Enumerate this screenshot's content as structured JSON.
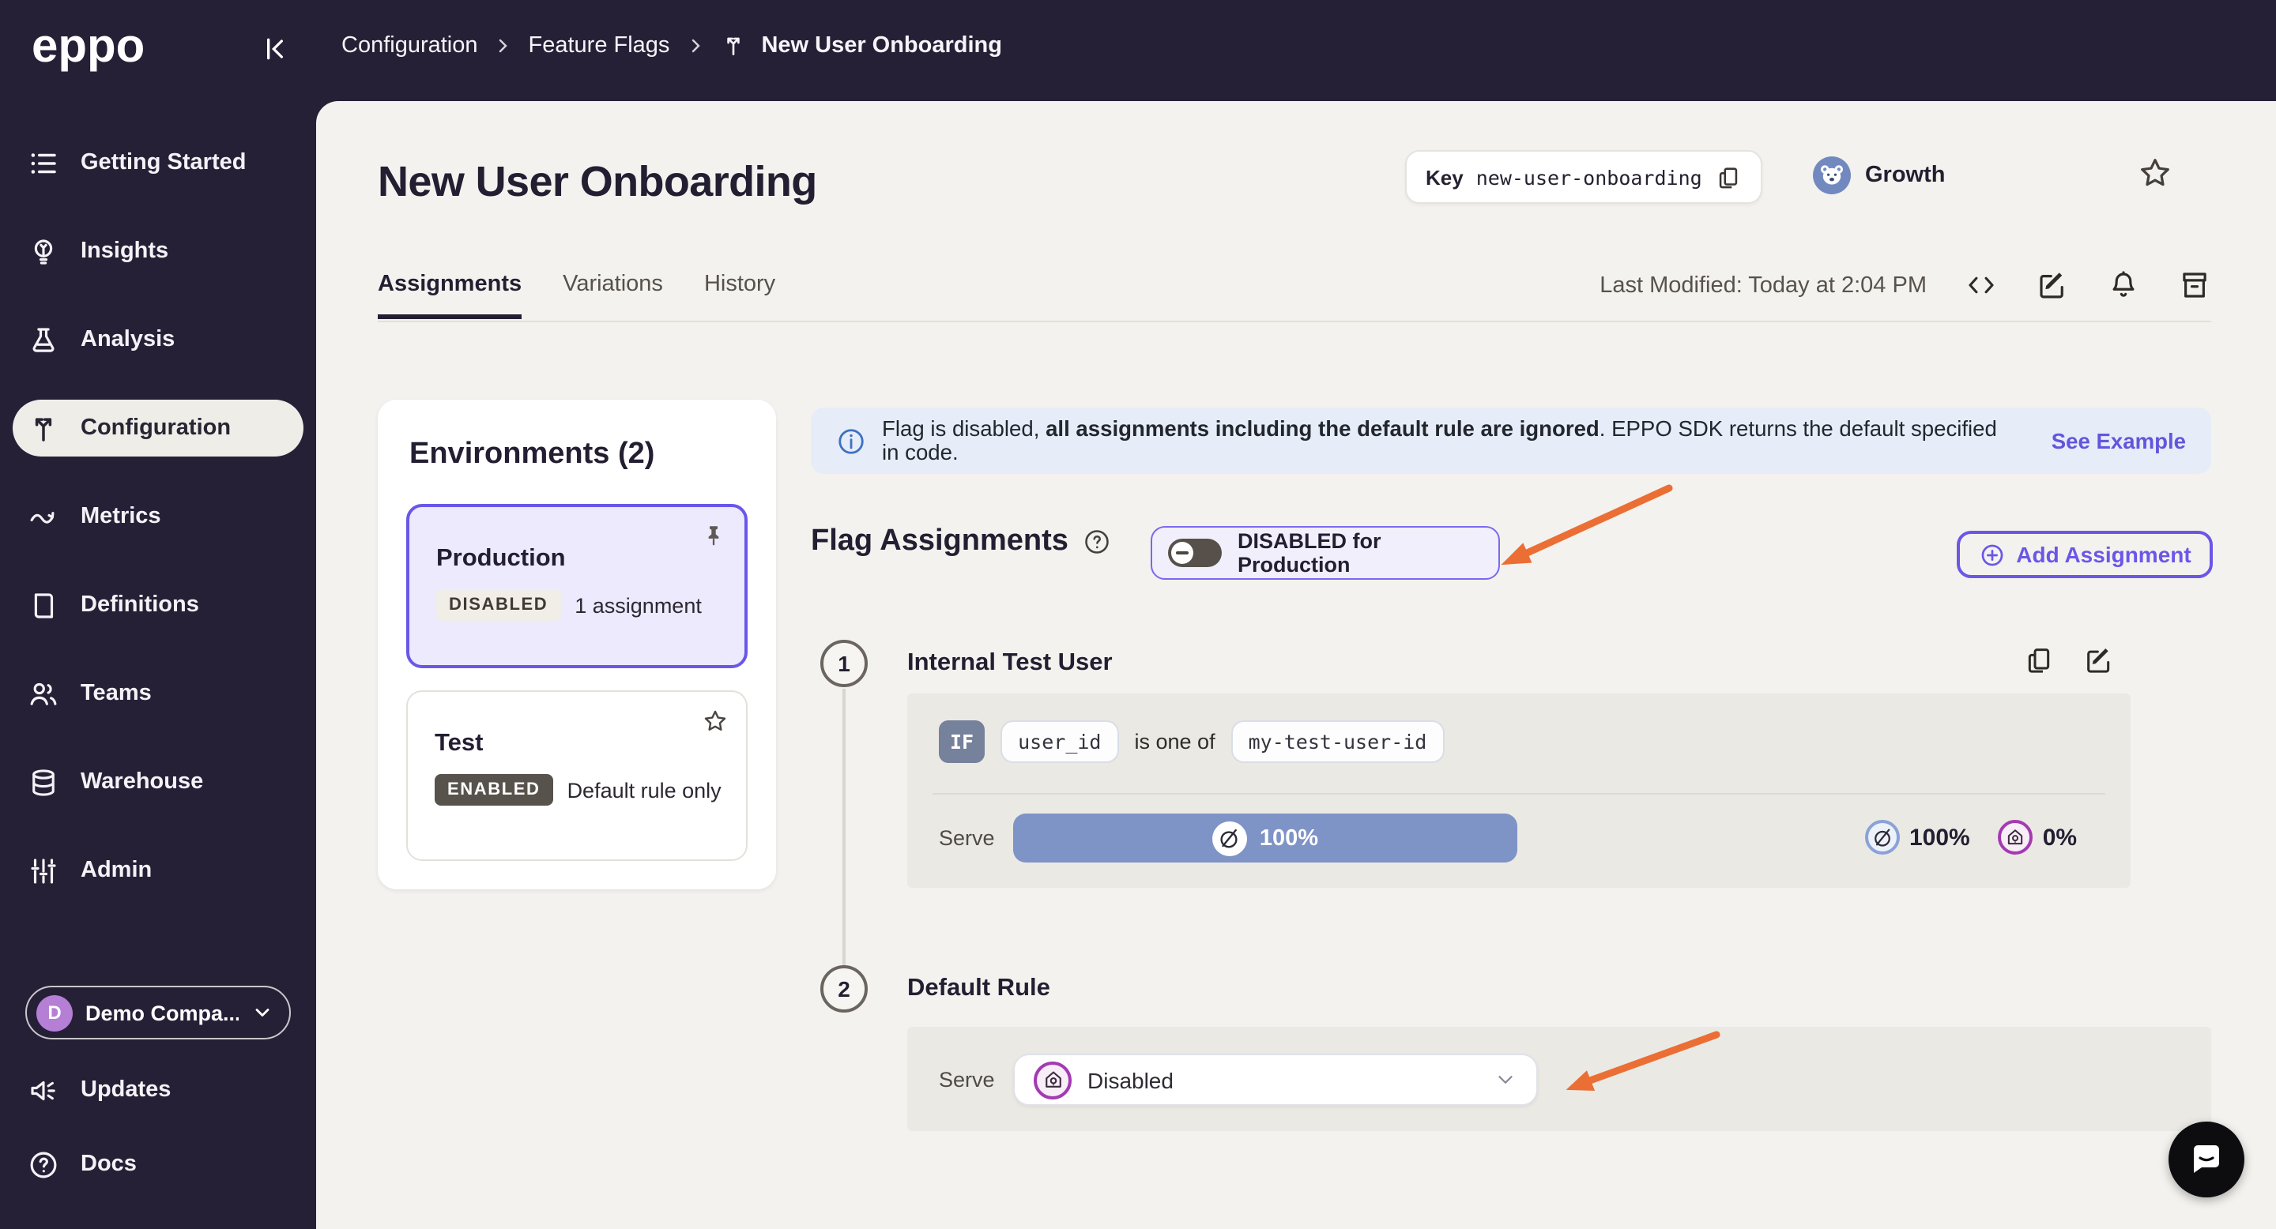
{
  "brand": {
    "logo_text": "eppo"
  },
  "breadcrumb": {
    "item1": "Configuration",
    "item2": "Feature Flags",
    "item3": "New User Onboarding"
  },
  "sidebar": {
    "items": [
      {
        "label": "Getting Started"
      },
      {
        "label": "Insights"
      },
      {
        "label": "Analysis"
      },
      {
        "label": "Configuration"
      },
      {
        "label": "Metrics"
      },
      {
        "label": "Definitions"
      },
      {
        "label": "Teams"
      },
      {
        "label": "Warehouse"
      },
      {
        "label": "Admin"
      }
    ],
    "account": {
      "initial": "D",
      "name": "Demo Compa..."
    },
    "updates_label": "Updates",
    "docs_label": "Docs"
  },
  "header": {
    "title": "New User Onboarding",
    "key_label": "Key",
    "key_value": "new-user-onboarding",
    "team_name": "Growth",
    "tabs": [
      {
        "label": "Assignments"
      },
      {
        "label": "Variations"
      },
      {
        "label": "History"
      }
    ],
    "last_modified": "Last Modified: Today at 2:04 PM"
  },
  "environments": {
    "title": "Environments (2)",
    "cards": [
      {
        "name": "Production",
        "status": "DISABLED",
        "detail": "1 assignment"
      },
      {
        "name": "Test",
        "status": "ENABLED",
        "detail": "Default rule only"
      }
    ]
  },
  "banner": {
    "text_prefix": "Flag is disabled, ",
    "text_bold": "all assignments including the default rule are ignored",
    "text_suffix": ". EPPO SDK returns the default specified in code.",
    "link_label": "See Example"
  },
  "assignments": {
    "heading": "Flag Assignments",
    "toggle_label": "DISABLED for Production",
    "add_button_label": "Add Assignment",
    "rules": [
      {
        "number": "1",
        "name": "Internal Test User",
        "if_label": "IF",
        "attribute": "user_id",
        "operator": "is one of",
        "value": "my-test-user-id",
        "serve_label": "Serve",
        "bar_percent": "100%",
        "legend": [
          {
            "percent": "100%"
          },
          {
            "percent": "0%"
          }
        ]
      },
      {
        "number": "2",
        "name": "Default Rule",
        "serve_label": "Serve",
        "serve_value": "Disabled"
      }
    ]
  },
  "colors": {
    "accent_purple": "#6a57e8",
    "serve_bar_blue": "#7e93c6",
    "variation_magenta": "#a43ab2",
    "link_blue": "#6355dd",
    "arrow_orange": "#eb6e35"
  }
}
